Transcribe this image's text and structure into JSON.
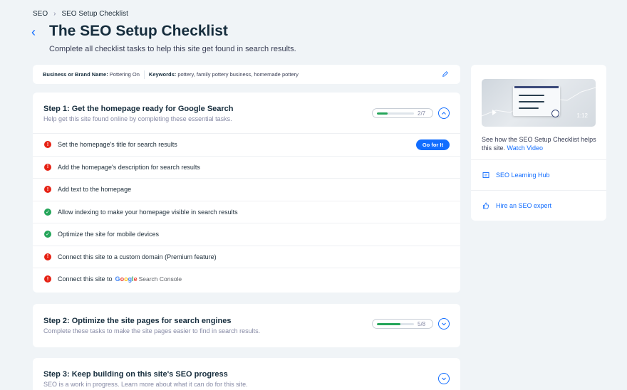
{
  "breadcrumb": {
    "root": "SEO",
    "current": "SEO Setup Checklist"
  },
  "header": {
    "title": "The SEO Setup Checklist",
    "subtitle": "Complete all checklist tasks to help this site get found in search results."
  },
  "brand": {
    "name_label": "Business or Brand Name:",
    "name_value": "Pottering On",
    "keywords_label": "Keywords:",
    "keywords_value": "pottery, family pottery business, homemade pottery"
  },
  "step1": {
    "title": "Step 1: Get the homepage ready for Google Search",
    "desc": "Help get this site found online by completing these essential tasks.",
    "progress_text": "2/7",
    "progress_fraction": 0.2857,
    "go_label": "Go for It",
    "tasks": [
      {
        "label": "Set the homepage's title for search results",
        "status": "error"
      },
      {
        "label": "Add the homepage's description for search results",
        "status": "error"
      },
      {
        "label": "Add text to the homepage",
        "status": "error"
      },
      {
        "label": "Allow indexing to make your homepage visible in search results",
        "status": "done"
      },
      {
        "label": "Optimize the site for mobile devices",
        "status": "done"
      },
      {
        "label": "Connect this site to a custom domain (Premium feature)",
        "status": "error"
      },
      {
        "label": "Connect this site to",
        "status": "error"
      }
    ],
    "google_letters": [
      "G",
      "o",
      "o",
      "g",
      "l",
      "e"
    ],
    "search_console": "Search Console"
  },
  "step2": {
    "title": "Step 2: Optimize the site pages for search engines",
    "desc": "Complete these tasks to make the site pages easier to find in search results.",
    "progress_text": "5/8",
    "progress_fraction": 0.625
  },
  "step3": {
    "title": "Step 3: Keep building on this site's SEO progress",
    "desc": "SEO is a work in progress. Learn more about what it can do for this site."
  },
  "side": {
    "video_time": "1:12",
    "text": "See how the SEO Setup Checklist helps this site.",
    "watch_link": "Watch Video",
    "hub_link": "SEO Learning Hub",
    "expert_link": "Hire an SEO expert"
  },
  "colors": {
    "accent": "#116dff",
    "error": "#e62214",
    "success": "#25a55a"
  }
}
